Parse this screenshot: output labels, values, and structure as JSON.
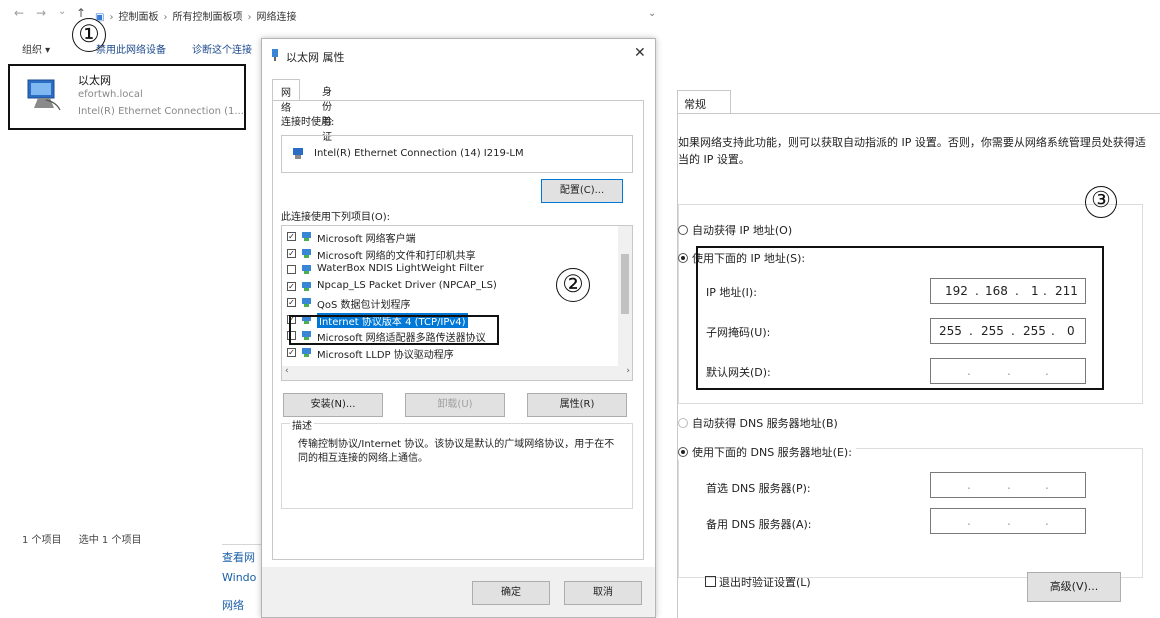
{
  "explorer": {
    "address_crumbs": [
      "控制面板",
      "所有控制面板项",
      "网络连接"
    ],
    "toolbar": {
      "organize": "组织 ▾",
      "disable": "禁用此网络设备",
      "diagnose": "诊断这个连接"
    },
    "adapter": {
      "name": "以太网",
      "host": "efortwh.local",
      "description": "Intel(R) Ethernet Connection (1..."
    },
    "status": {
      "count": "1 个项目",
      "selected": "选中 1 个项目"
    },
    "side_links": [
      "查看网",
      "Windo",
      "网络"
    ]
  },
  "annotations": {
    "step1": "①",
    "step2": "②",
    "step3": "③"
  },
  "dialog": {
    "title": "以太网 属性",
    "tabs": [
      "网络",
      "身份验证"
    ],
    "connect_using_label": "连接时使用:",
    "adapter_name": "Intel(R) Ethernet Connection (14) I219-LM",
    "configure_button": "配置(C)...",
    "items_label": "此连接使用下列项目(O):",
    "items": [
      {
        "label": "Microsoft 网络客户端",
        "checked": true
      },
      {
        "label": "Microsoft 网络的文件和打印机共享",
        "checked": true
      },
      {
        "label": "WaterBox NDIS LightWeight Filter",
        "checked": false
      },
      {
        "label": "Npcap_LS Packet Driver (NPCAP_LS)",
        "checked": true
      },
      {
        "label": "QoS 数据包计划程序",
        "checked": true
      },
      {
        "label": "Internet 协议版本 4 (TCP/IPv4)",
        "checked": true,
        "selected": true
      },
      {
        "label": "Microsoft 网络适配器多路传送器协议",
        "checked": false
      },
      {
        "label": "Microsoft LLDP 协议驱动程序",
        "checked": true
      }
    ],
    "install_button": "安装(N)...",
    "uninstall_button": "卸载(U)",
    "properties_button": "属性(R)",
    "description_title": "描述",
    "description_text": "传输控制协议/Internet 协议。该协议是默认的广域网络协议，用于在不同的相互连接的网络上通信。",
    "ok_button": "确定",
    "cancel_button": "取消"
  },
  "ipv4": {
    "tab": "常规",
    "intro": "如果网络支持此功能，则可以获取自动指派的 IP 设置。否则，你需要从网络系统管理员处获得适当的 IP 设置。",
    "auto_ip_label": "自动获得 IP 地址(O)",
    "manual_ip_label": "使用下面的 IP 地址(S):",
    "ip_label": "IP 地址(I):",
    "ip_value": [
      "192",
      "168",
      "1",
      "211"
    ],
    "mask_label": "子网掩码(U):",
    "mask_value": [
      "255",
      "255",
      "255",
      "0"
    ],
    "gateway_label": "默认网关(D):",
    "auto_dns_label": "自动获得 DNS 服务器地址(B)",
    "manual_dns_label": "使用下面的 DNS 服务器地址(E):",
    "preferred_dns_label": "首选 DNS 服务器(P):",
    "alternate_dns_label": "备用 DNS 服务器(A):",
    "validate_label": "退出时验证设置(L)",
    "advanced_button": "高级(V)...",
    "empty_dot": "."
  }
}
